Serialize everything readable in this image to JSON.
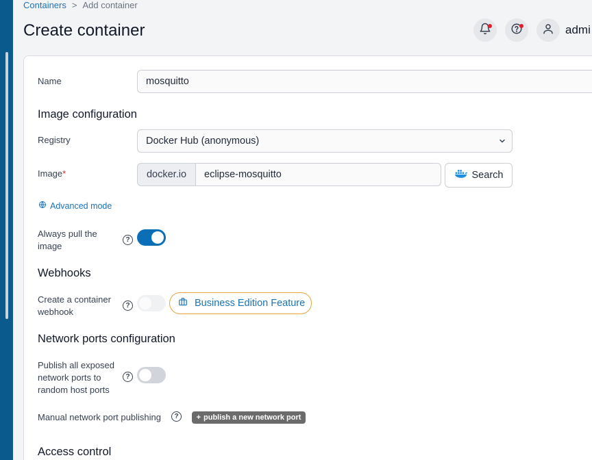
{
  "breadcrumb": {
    "parent": "Containers",
    "separator": ">",
    "current": "Add container"
  },
  "page": {
    "title": "Create container"
  },
  "header": {
    "user": "admi"
  },
  "form": {
    "name_label": "Name",
    "name_value": "mosquitto",
    "image_section": "Image configuration",
    "registry_label": "Registry",
    "registry_value": "Docker Hub (anonymous)",
    "image_label": "Image",
    "image_required": "*",
    "image_prefix": "docker.io",
    "image_value": "eclipse-mosquitto",
    "search_label": "Search",
    "advanced_mode": "Advanced mode",
    "always_pull_label": "Always pull the image",
    "always_pull_enabled": true,
    "webhooks_section": "Webhooks",
    "webhook_label": "Create a container webhook",
    "webhook_enabled": false,
    "business_edition": "Business Edition Feature",
    "network_section": "Network ports configuration",
    "publish_all_label": "Publish all exposed network ports to random host ports",
    "publish_all_enabled": false,
    "manual_publish_label": "Manual network port publishing",
    "publish_new_port": "publish a new network port",
    "access_section": "Access control"
  },
  "colors": {
    "accent": "#0b6fb8",
    "sidebar": "#0b5a8e",
    "badge_border": "#e7a33c",
    "notification_dot": "#e11d2e"
  },
  "icons": [
    "bell-icon",
    "help-circle-icon",
    "user-icon",
    "chevron-down-icon",
    "docker-icon",
    "globe-icon",
    "briefcase-icon",
    "plus-icon"
  ]
}
